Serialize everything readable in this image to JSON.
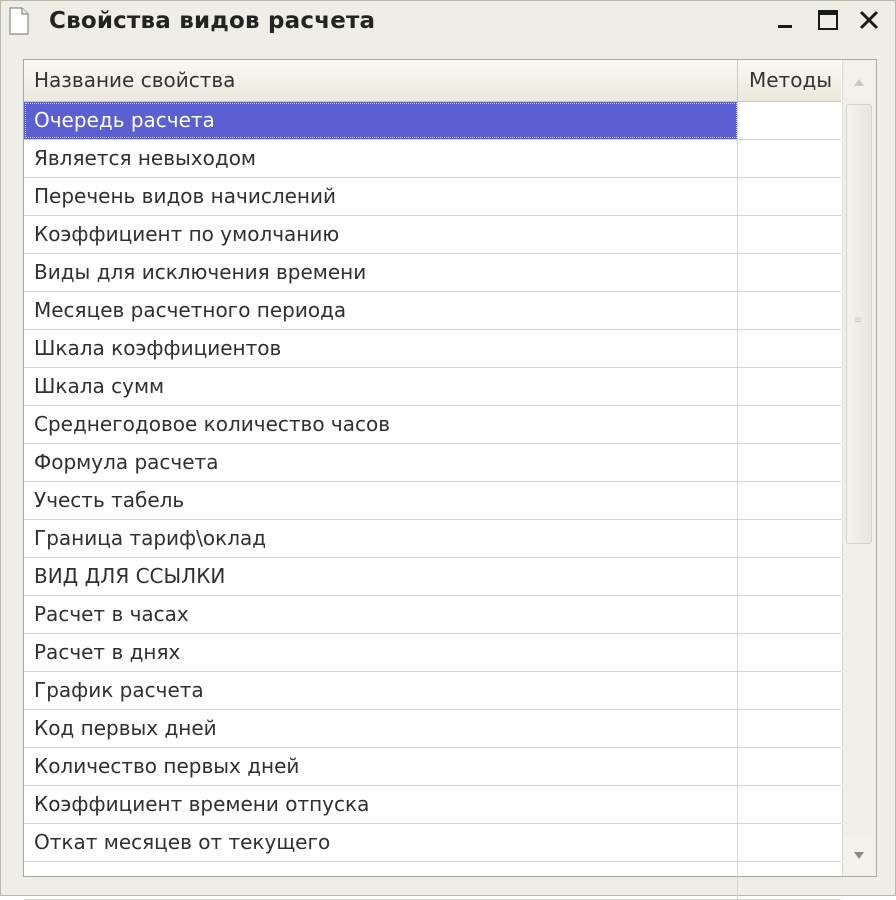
{
  "window": {
    "title": "Свойства видов расчета",
    "icons": {
      "document": "document-icon",
      "minimize": "minimize-icon",
      "maximize": "maximize-icon",
      "close": "close-icon"
    }
  },
  "table": {
    "columns": [
      "Название свойства",
      "Методы"
    ],
    "selected_index": 0,
    "selection_color": "#5c5fd2",
    "rows": [
      {
        "name": "Очередь расчета",
        "methods": ""
      },
      {
        "name": "Является невыходом",
        "methods": ""
      },
      {
        "name": "Перечень видов начислений",
        "methods": ""
      },
      {
        "name": "Коэффициент по умолчанию",
        "methods": ""
      },
      {
        "name": "Виды для исключения времени",
        "methods": ""
      },
      {
        "name": "Месяцев расчетного периода",
        "methods": ""
      },
      {
        "name": "Шкала коэффициентов",
        "methods": ""
      },
      {
        "name": "Шкала сумм",
        "methods": ""
      },
      {
        "name": "Среднегодовое количество часов",
        "methods": ""
      },
      {
        "name": "Формула расчета",
        "methods": ""
      },
      {
        "name": "Учесть табель",
        "methods": ""
      },
      {
        "name": "Граница тариф\\оклад",
        "methods": ""
      },
      {
        "name": "ВИД ДЛЯ ССЫЛКИ",
        "methods": ""
      },
      {
        "name": "Расчет в часах",
        "methods": ""
      },
      {
        "name": "Расчет в днях",
        "methods": ""
      },
      {
        "name": "График расчета",
        "methods": ""
      },
      {
        "name": "Код первых дней",
        "methods": ""
      },
      {
        "name": "Количество первых дней",
        "methods": ""
      },
      {
        "name": "Коэффициент времени отпуска",
        "methods": ""
      },
      {
        "name": "Откат месяцев от текущего",
        "methods": ""
      },
      {
        "name": "",
        "methods": ""
      }
    ]
  },
  "scrollbar": {
    "up_icon": "scroll-up-arrow-icon",
    "down_icon": "scroll-down-arrow-icon"
  }
}
